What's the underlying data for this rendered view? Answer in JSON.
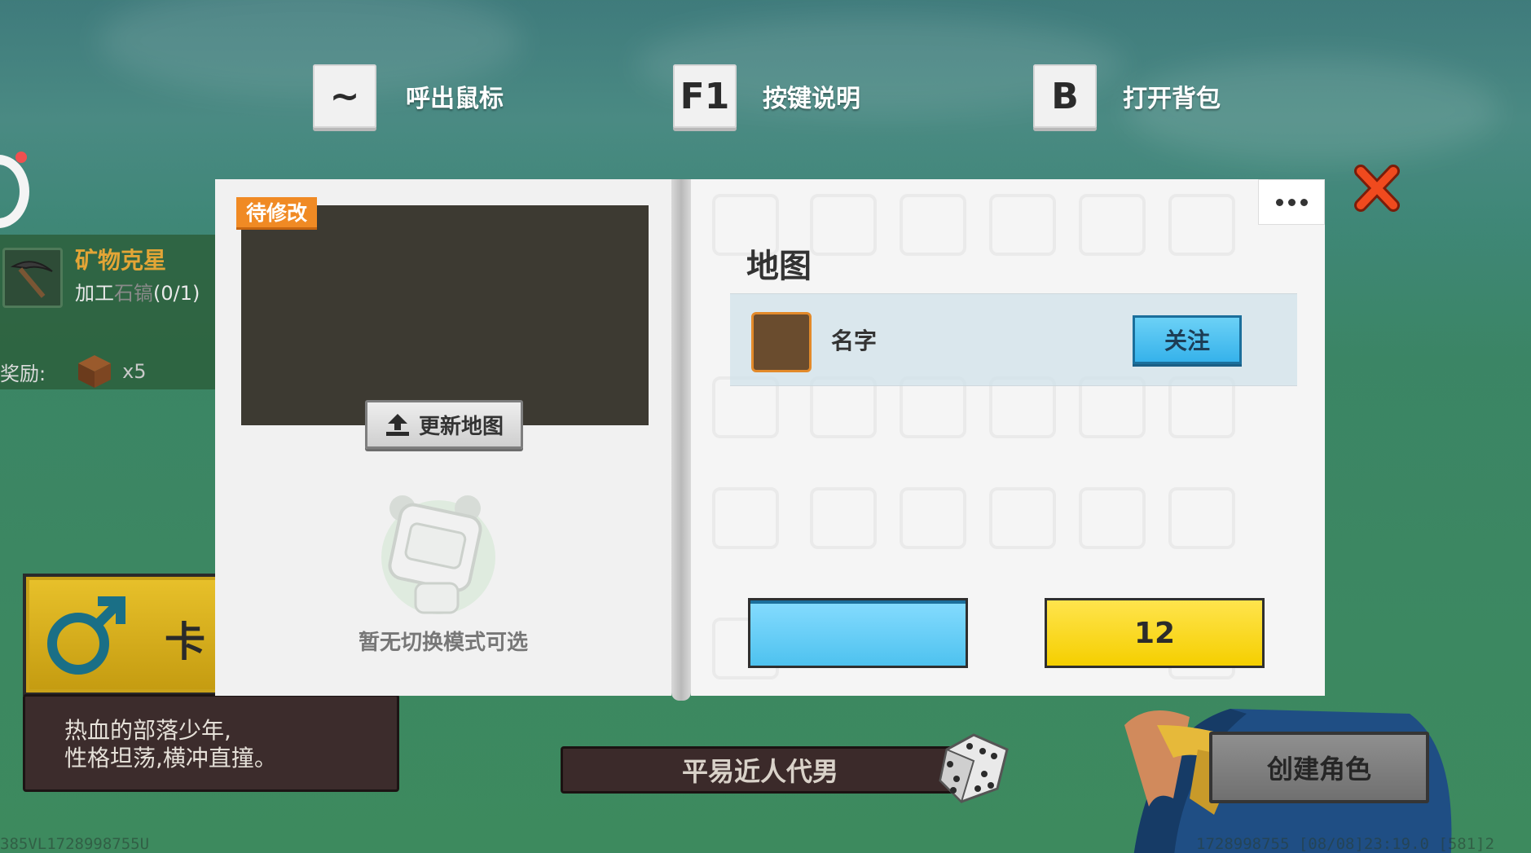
{
  "hints": [
    {
      "key": "~",
      "label": "呼出鼠标"
    },
    {
      "key": "F1",
      "label": "按键说明"
    },
    {
      "key": "B",
      "label": "打开背包"
    }
  ],
  "quest": {
    "title": "矿物克星",
    "task_prefix": "加工",
    "task_item": "石镐",
    "task_progress": "(0/1)",
    "reward_label": "奖励:",
    "reward_count": "x5"
  },
  "character": {
    "gender_icon": "male-symbol-icon",
    "name_partial": "卡",
    "desc_line1": "热血的部落少年,",
    "desc_line2": "性格坦荡,横冲直撞。",
    "trait_name": "平易近人代男",
    "create_label": "创建角色"
  },
  "dialog": {
    "status_tag": "待修改",
    "update_map_label": "更新地图",
    "empty_mode_text": "暂无切换模式可选",
    "map_title": "地图",
    "author_name": "名字",
    "follow_label": "关注",
    "blue_button_label": "",
    "yellow_button_value": "12"
  },
  "footer": {
    "version_left": "385VL1728998755U",
    "version_right": "1728998755   [08/08]23:19.0   [581]2"
  },
  "colors": {
    "accent_orange": "#f08a24",
    "follow_blue": "#36b2eb",
    "yellow": "#f5cf00",
    "close_red": "#f04a1e"
  }
}
